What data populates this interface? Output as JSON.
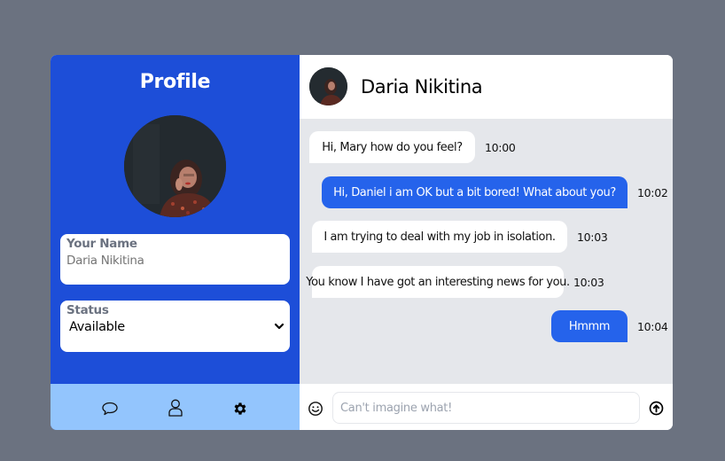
{
  "colors": {
    "page_bg": "#6b7280",
    "sidebar_bg": "#1d4ed8",
    "sidebar_footer_bg": "#93c5fd",
    "chat_bg": "#e5e7eb",
    "outgoing_bubble": "#2563eb",
    "incoming_bubble": "#ffffff"
  },
  "sidebar": {
    "title": "Profile",
    "avatar_alt": "profile-photo",
    "name_field": {
      "label": "Your Name",
      "placeholder": "Daria Nikitina",
      "value": ""
    },
    "status_field": {
      "label": "Status",
      "selected": "Available"
    },
    "footer_icons": [
      {
        "name": "chat-bubble-icon"
      },
      {
        "name": "user-icon"
      },
      {
        "name": "gear-icon"
      }
    ]
  },
  "chat": {
    "contact_name": "Daria Nikitina",
    "messages": [
      {
        "direction": "in",
        "text": "Hi, Mary how do you feel?",
        "time": "10:00"
      },
      {
        "direction": "out",
        "text": "Hi, Daniel i am OK but a bit bored! What about you?",
        "time": "10:02"
      },
      {
        "direction": "in",
        "text": "I am trying to deal with my job in isolation.",
        "time": "10:03"
      },
      {
        "direction": "in",
        "text": "You know I have got an interesting news for you.",
        "time": "10:03"
      },
      {
        "direction": "out",
        "text": "Hmmm",
        "time": "10:04"
      }
    ],
    "composer": {
      "placeholder": "Can't imagine what!",
      "value": "",
      "emoji_icon": "smiley-icon",
      "send_icon": "arrow-up-circle-icon"
    }
  }
}
